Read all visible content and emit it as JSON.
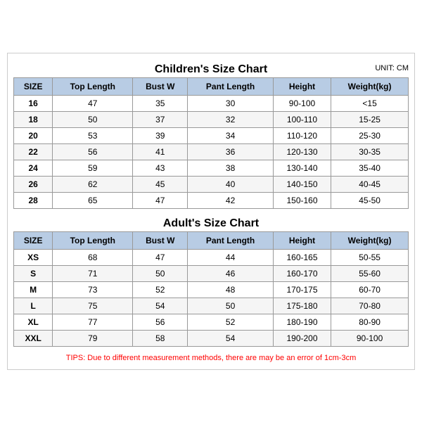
{
  "children_chart": {
    "title": "Children's Size Chart",
    "unit": "UNIT: CM",
    "headers": [
      "SIZE",
      "Top Length",
      "Bust W",
      "Pant Length",
      "Height",
      "Weight(kg)"
    ],
    "rows": [
      [
        "16",
        "47",
        "35",
        "30",
        "90-100",
        "<15"
      ],
      [
        "18",
        "50",
        "37",
        "32",
        "100-110",
        "15-25"
      ],
      [
        "20",
        "53",
        "39",
        "34",
        "110-120",
        "25-30"
      ],
      [
        "22",
        "56",
        "41",
        "36",
        "120-130",
        "30-35"
      ],
      [
        "24",
        "59",
        "43",
        "38",
        "130-140",
        "35-40"
      ],
      [
        "26",
        "62",
        "45",
        "40",
        "140-150",
        "40-45"
      ],
      [
        "28",
        "65",
        "47",
        "42",
        "150-160",
        "45-50"
      ]
    ]
  },
  "adults_chart": {
    "title": "Adult's Size Chart",
    "headers": [
      "SIZE",
      "Top Length",
      "Bust W",
      "Pant Length",
      "Height",
      "Weight(kg)"
    ],
    "rows": [
      [
        "XS",
        "68",
        "47",
        "44",
        "160-165",
        "50-55"
      ],
      [
        "S",
        "71",
        "50",
        "46",
        "160-170",
        "55-60"
      ],
      [
        "M",
        "73",
        "52",
        "48",
        "170-175",
        "60-70"
      ],
      [
        "L",
        "75",
        "54",
        "50",
        "175-180",
        "70-80"
      ],
      [
        "XL",
        "77",
        "56",
        "52",
        "180-190",
        "80-90"
      ],
      [
        "XXL",
        "79",
        "58",
        "54",
        "190-200",
        "90-100"
      ]
    ]
  },
  "tips": "TIPS: Due to different measurement methods, there are may be an error of 1cm-3cm"
}
